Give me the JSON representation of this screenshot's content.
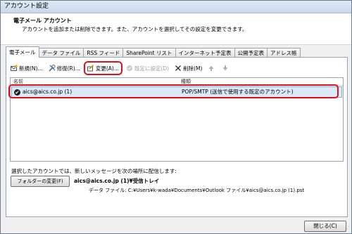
{
  "window": {
    "title": "アカウント設定"
  },
  "header": {
    "title": "電子メール アカウント",
    "subtitle": "アカウントを追加または削除できます。また、アカウントを選択してその設定を変更できます。"
  },
  "tabs": [
    {
      "label": "電子メール"
    },
    {
      "label": "データ ファイル"
    },
    {
      "label": "RSS フィード"
    },
    {
      "label": "SharePoint リスト"
    },
    {
      "label": "インターネット予定表"
    },
    {
      "label": "公開予定表"
    },
    {
      "label": "アドレス帳"
    }
  ],
  "toolbar": {
    "new_label": "新規(N)...",
    "repair_label": "修復(R)...",
    "change_label": "変更(A)...",
    "default_label": "既定に設定(D)",
    "delete_label": "削除(M)"
  },
  "list": {
    "col_name": "名前",
    "col_type": "種類",
    "rows": [
      {
        "name": "aics@aics.co.jp (1)",
        "type": "POP/SMTP (送信で使用する既定のアカウント)"
      }
    ]
  },
  "delivery": {
    "label": "選択したアカウントでは、新しいメッセージを次の場所に配信します:",
    "button": "フォルダーの変更(F)",
    "location": "aics@aics.co.jp (1)¥受信トレイ",
    "datafile": "データ ファイル: C:¥Users¥k-wada¥Documents¥Outlook ファイル¥aics@aics.co.jp (1).pst"
  },
  "footer": {
    "close_label": "閉じる(C)"
  }
}
